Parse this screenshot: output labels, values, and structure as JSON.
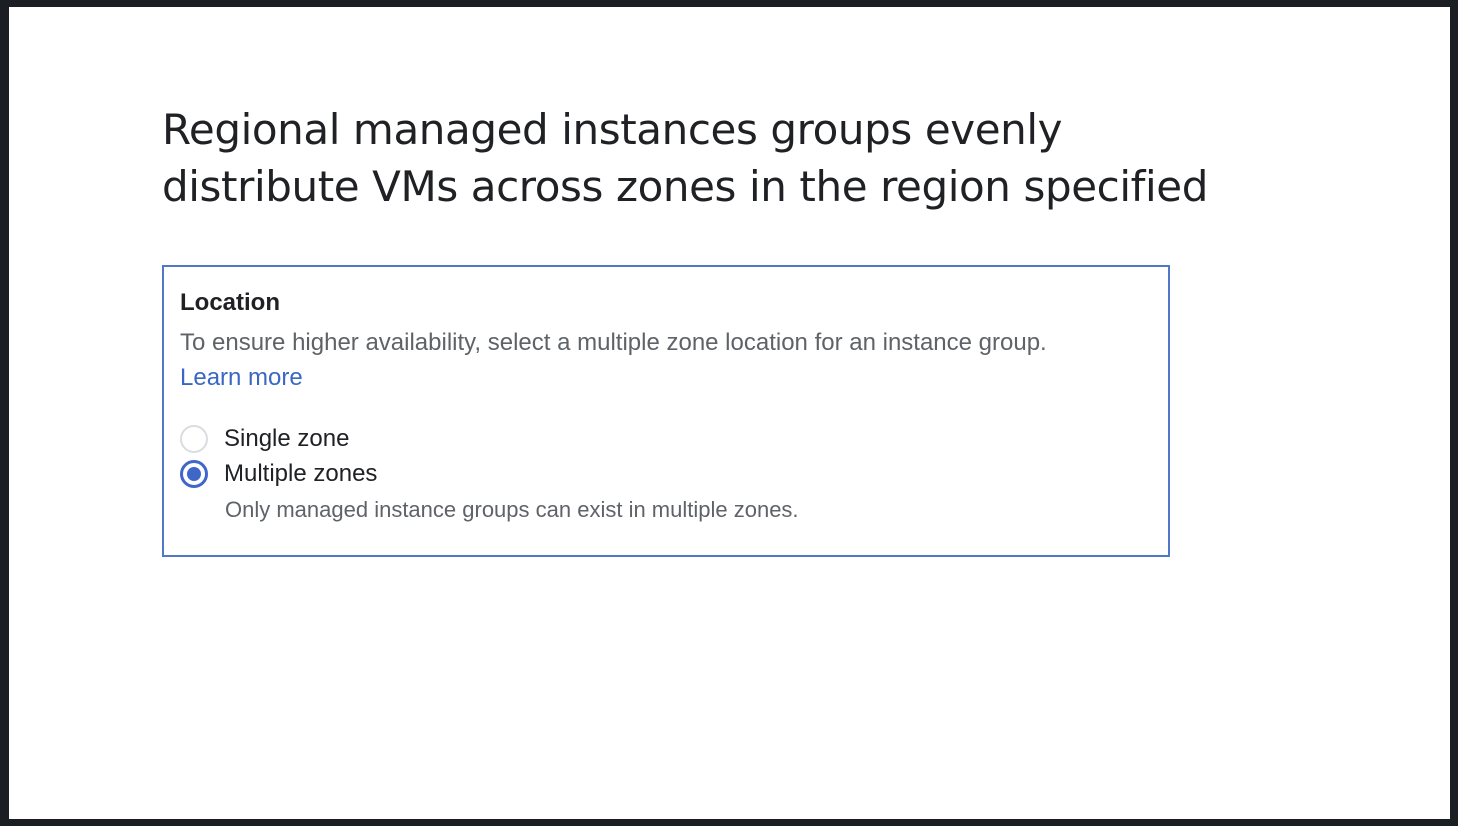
{
  "slide": {
    "title_line1": "Regional managed instances groups evenly",
    "title_line2": "distribute VMs across zones in the region specified"
  },
  "location": {
    "heading": "Location",
    "description": "To ensure higher availability, select a multiple zone location for an instance group.",
    "learn_more": "Learn more",
    "options": [
      {
        "label": "Single zone",
        "selected": false
      },
      {
        "label": "Multiple zones",
        "selected": true
      }
    ],
    "helper": "Only managed instance groups can exist in multiple zones.",
    "accent_color": "#3f66c9"
  }
}
